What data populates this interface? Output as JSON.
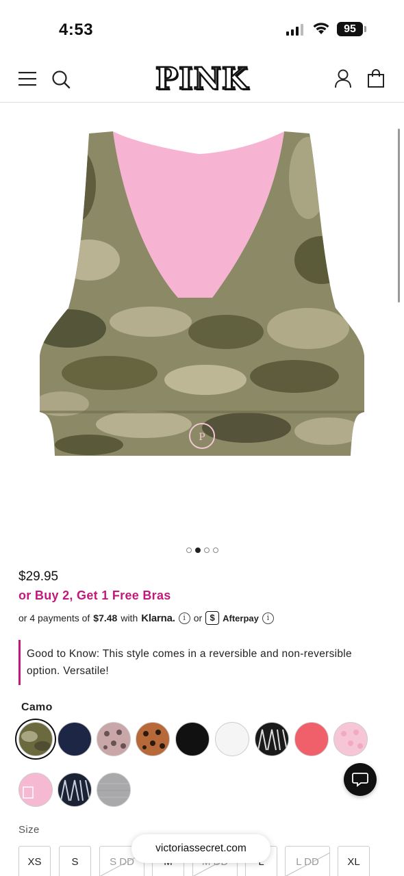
{
  "status_bar": {
    "time": "4:53",
    "battery": "95"
  },
  "header": {
    "logo": "PINK"
  },
  "product": {
    "image_dots": 4,
    "active_dot": 1,
    "price": "$29.95",
    "promo": "or Buy 2, Get 1 Free Bras",
    "payments": {
      "prefix": "or 4 payments of",
      "amount": "$7.48",
      "with": "with",
      "klarna": "Klarna.",
      "or": "or",
      "afterpay_symbol": "$",
      "afterpay": "Afterpay"
    },
    "good_to_know": "Good to Know: This style comes in a reversible and non-reversible option. Versatile!",
    "color_label": "Camo",
    "swatches": [
      {
        "name": "camo",
        "color": "#6b6a3e"
      },
      {
        "name": "navy",
        "color": "#1d2745"
      },
      {
        "name": "pink-leopard",
        "color": "#c9a6a8"
      },
      {
        "name": "tan-leopard",
        "color": "#b8693a"
      },
      {
        "name": "black",
        "color": "#111111"
      },
      {
        "name": "white",
        "color": "#f5f5f5"
      },
      {
        "name": "black-logo",
        "color": "#1a1a1a"
      },
      {
        "name": "coral",
        "color": "#f0606b"
      },
      {
        "name": "light-pink-leopard",
        "color": "#f7c6d6"
      },
      {
        "name": "pink-logo",
        "color": "#f6b9d2"
      },
      {
        "name": "navy-logo",
        "color": "#1a2233"
      },
      {
        "name": "heather-grey",
        "color": "#a9a9ab"
      }
    ],
    "size_label": "Size",
    "sizes": [
      {
        "label": "XS",
        "available": true
      },
      {
        "label": "S",
        "available": true
      },
      {
        "label": "S DD",
        "available": false
      },
      {
        "label": "M",
        "available": true
      },
      {
        "label": "M DD",
        "available": false
      },
      {
        "label": "L",
        "available": true
      },
      {
        "label": "L DD",
        "available": false
      },
      {
        "label": "XL",
        "available": true
      }
    ]
  },
  "browser": {
    "url": "victoriassecret.com"
  },
  "colors": {
    "accent": "#c2187b"
  }
}
